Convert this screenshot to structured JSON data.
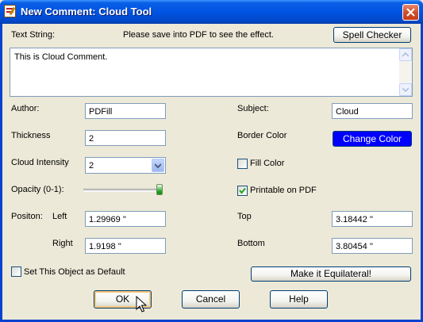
{
  "window": {
    "title": "New Comment: Cloud Tool",
    "icon": "pdf-comment-icon"
  },
  "text_string": {
    "label": "Text String:",
    "hint": "Please save into PDF to see the effect.",
    "value": "This is Cloud Comment.",
    "spell_checker_label": "Spell Checker"
  },
  "author": {
    "label": "Author:",
    "value": "PDFill"
  },
  "subject": {
    "label": "Subject:",
    "value": "Cloud"
  },
  "thickness": {
    "label": "Thickness",
    "value": "2"
  },
  "border_color": {
    "label": "Border Color",
    "button_label": "Change Color",
    "color": "#0000ff"
  },
  "cloud_intensity": {
    "label": "Cloud Intensity",
    "value": "2"
  },
  "fill_color": {
    "label": "Fill Color",
    "checked": false
  },
  "opacity": {
    "label": "Opacity (0-1):",
    "value": 1.0
  },
  "printable": {
    "label": "Printable on PDF",
    "checked": true
  },
  "position": {
    "label": "Positon:",
    "left_label": "Left",
    "left_value": "1.29969 ''",
    "right_label": "Right",
    "right_value": "1.9198 ''",
    "top_label": "Top",
    "top_value": "3.18442 ''",
    "bottom_label": "Bottom",
    "bottom_value": "3.80454 ''"
  },
  "set_default": {
    "label": "Set This Object as Default",
    "checked": false
  },
  "equilateral_label": "Make it Equilateral!",
  "buttons": {
    "ok": "OK",
    "cancel": "Cancel",
    "help": "Help"
  },
  "colors": {
    "titlebar": "#0054e3",
    "dialog_bg": "#ece9d8",
    "check_green": "#21a121"
  }
}
